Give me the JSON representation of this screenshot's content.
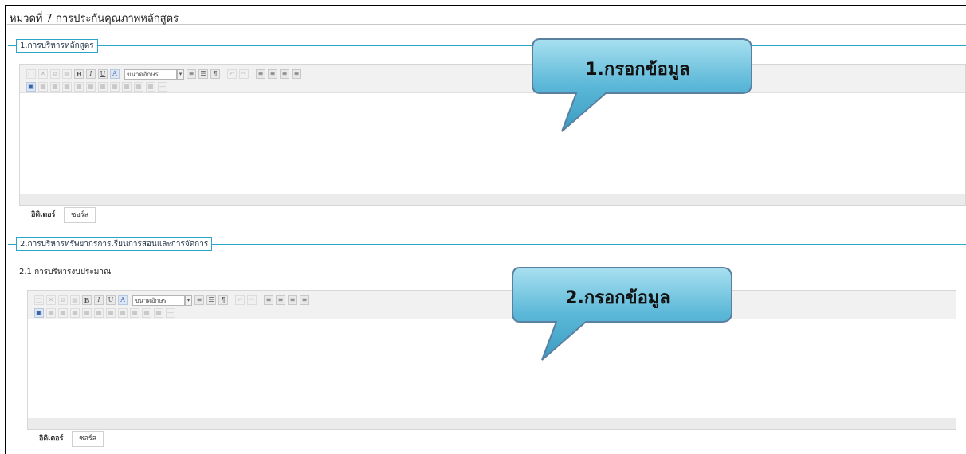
{
  "page": {
    "title": "หมวดที่ 7 การประกันคุณภาพหลักสูตร"
  },
  "sections": [
    {
      "legend": "1.การบริหารหลักสูตร",
      "editor": {
        "font_size_placeholder": "ขนาดอักษร",
        "tabs": [
          "อิดิเตอร์",
          "ซอร์ส"
        ],
        "active_tab": "อิดิเตอร์"
      }
    },
    {
      "legend": "2.การบริหารทรัพยากรการเรียนการสอนและการจัดการ",
      "sub_label": "2.1 การบริหารงบประมาณ",
      "editor": {
        "font_size_placeholder": "ขนาดอักษร",
        "tabs": [
          "อิดิเตอร์",
          "ซอร์ส"
        ],
        "active_tab": "อิดิเตอร์"
      }
    }
  ],
  "callouts": [
    {
      "text": "1.กรอกข้อมูล"
    },
    {
      "text": "2.กรอกข้อมูล"
    }
  ],
  "colors": {
    "legend_border": "#2aa5c8",
    "callout_top": "#8fd3e8",
    "callout_bottom": "#3d9fc4",
    "callout_border": "#5a7fa0"
  },
  "icons": {
    "toolbar_row1": [
      "new-doc-icon",
      "cut-icon",
      "copy-icon",
      "paste-icon",
      "bold-icon",
      "italic-icon",
      "underline-icon",
      "font-color-icon",
      "font-size-select",
      "bullet-list-icon",
      "numbered-list-icon",
      "paragraph-icon",
      "undo-icon",
      "redo-icon",
      "align-left-icon",
      "align-center-icon",
      "align-right-icon",
      "justify-icon"
    ],
    "toolbar_row2": [
      "image-icon",
      "table-icon",
      "insert-row-icon",
      "insert-column-icon",
      "delete-row-icon",
      "delete-column-icon",
      "merge-cells-icon",
      "split-cells-icon",
      "cell-props-icon",
      "table-props-icon",
      "link-icon",
      "hr-icon"
    ]
  }
}
